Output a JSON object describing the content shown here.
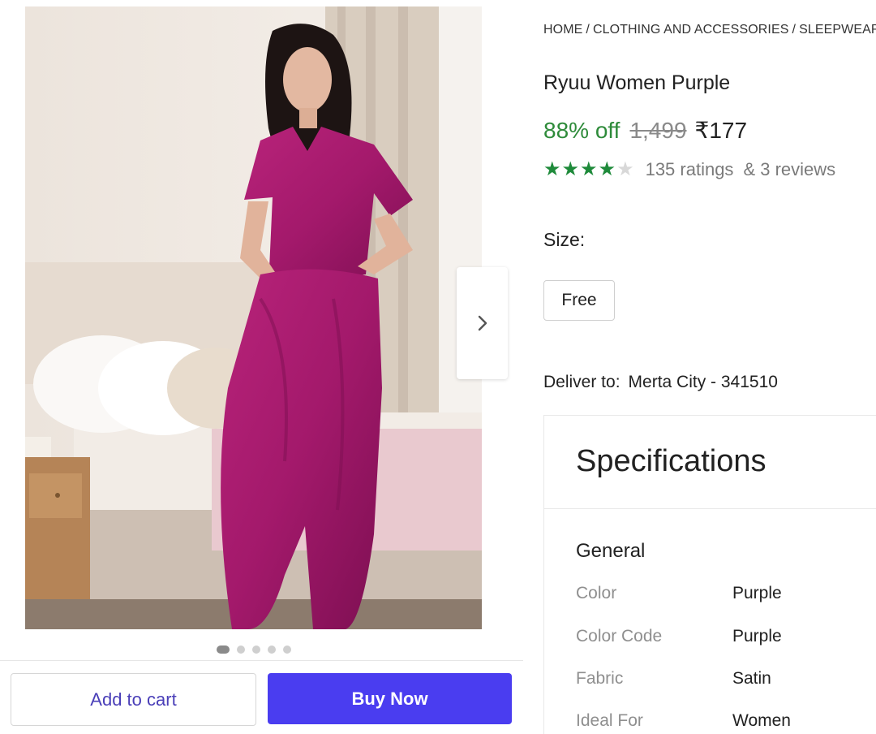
{
  "breadcrumb": [
    "HOME",
    "CLOTHING AND ACCESSORIES",
    "SLEEPWEAR"
  ],
  "product": {
    "title": "Ryuu Women Purple",
    "discount": "88% off",
    "mrp": "1,499",
    "price": "₹177",
    "rating_stars": 4,
    "rating_max": 5,
    "ratings_text": "135 ratings",
    "reviews_text": "& 3 reviews"
  },
  "gallery": {
    "image_count": 5,
    "active_index": 0,
    "image_icon": "photo-woman-purple-dhoti-set",
    "next_icon": "chevron-right-icon"
  },
  "size": {
    "label": "Size:",
    "options": [
      "Free"
    ]
  },
  "delivery": {
    "label": "Deliver to:",
    "location": "Merta City - 341510"
  },
  "specifications": {
    "title": "Specifications",
    "group": "General",
    "rows": [
      {
        "key": "Color",
        "value": "Purple"
      },
      {
        "key": "Color Code",
        "value": "Purple"
      },
      {
        "key": "Fabric",
        "value": "Satin"
      },
      {
        "key": "Ideal For",
        "value": "Women"
      }
    ]
  },
  "actions": {
    "add_to_cart": "Add to cart",
    "buy_now": "Buy Now"
  },
  "colors": {
    "discount": "#2e8b3a",
    "buy_button": "#4a3df0",
    "add_to_cart_text": "#4a3fb8",
    "star_on": "#1e8a3a",
    "garment": "#a3196b"
  }
}
